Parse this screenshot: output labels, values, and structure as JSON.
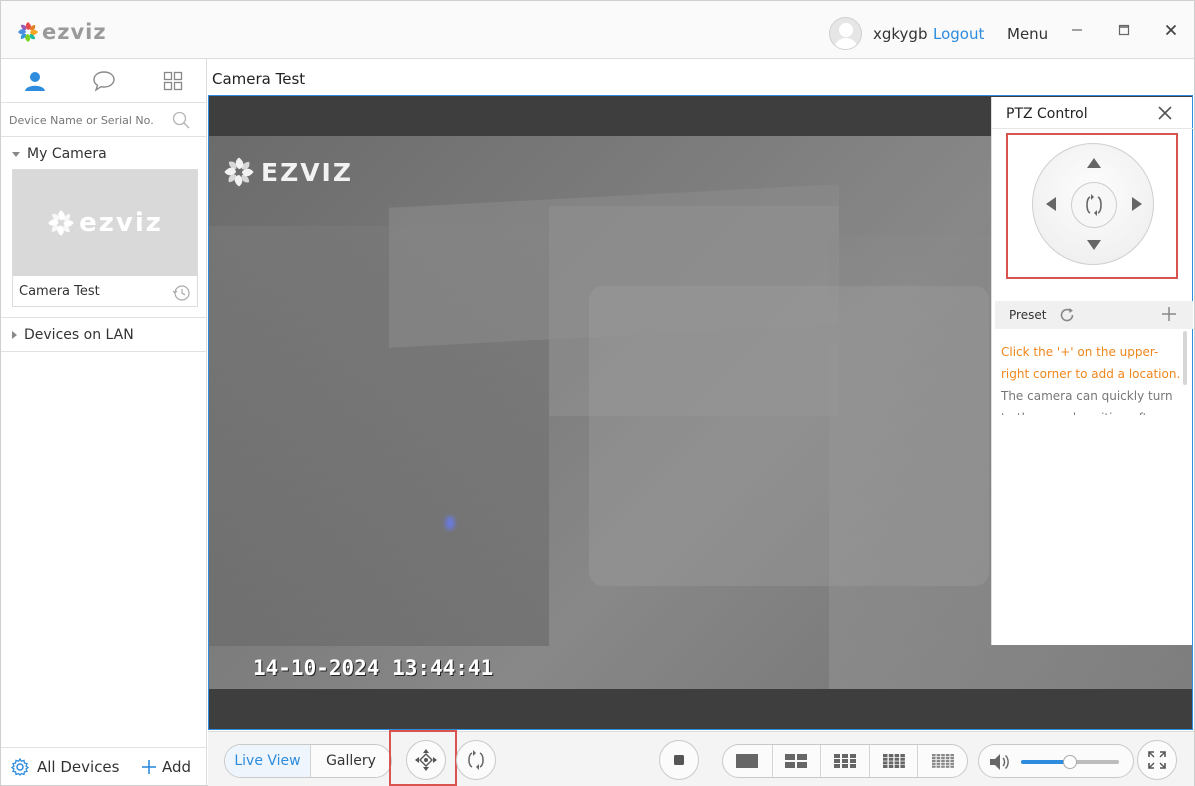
{
  "app": {
    "logo_text": "ezviz",
    "username": "xgkygb",
    "logout_label": "Logout",
    "menu_label": "Menu"
  },
  "sidebar": {
    "search_placeholder": "Device Name or Serial No.",
    "my_camera_label": "My Camera",
    "camera_card": {
      "thumbnail_logo": "ezviz",
      "name": "Camera Test"
    },
    "lan_label": "Devices on LAN",
    "all_devices_label": "All Devices",
    "add_label": "Add"
  },
  "main": {
    "camera_title": "Camera Test",
    "watermark": "EZVIZ",
    "osd_timestamp": "14-10-2024 13:44:41"
  },
  "ptz": {
    "title": "PTZ Control",
    "preset_label": "Preset",
    "hint": "Click the '+' on the upper-right corner to add a location.",
    "description": "The camera can quickly turn to the saved position after set"
  },
  "toolbar": {
    "live_view_label": "Live View",
    "gallery_label": "Gallery",
    "volume_level": 0.5
  },
  "colors": {
    "accent": "#2d8cde",
    "highlight_box": "#d9534f",
    "hint_text": "#f0861c"
  }
}
